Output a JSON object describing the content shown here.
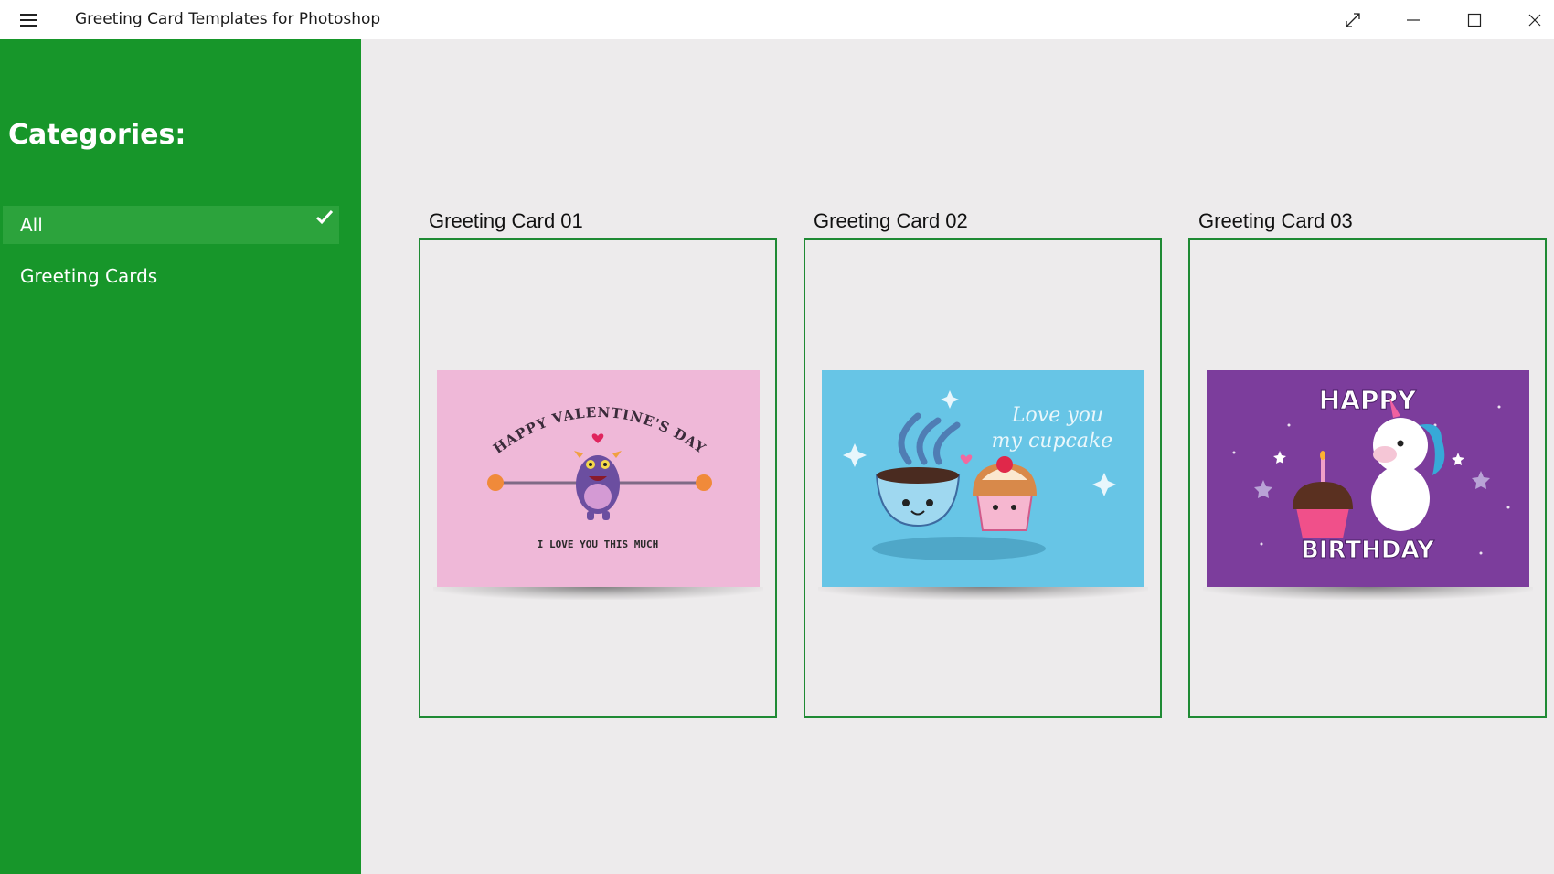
{
  "window": {
    "title": "Greeting Card Templates for Photoshop"
  },
  "sidebar": {
    "heading": "Categories:",
    "items": [
      {
        "label": "All",
        "selected": true
      },
      {
        "label": "Greeting Cards",
        "selected": false
      }
    ]
  },
  "cards": [
    {
      "title": "Greeting Card 01",
      "art_text_top": "HAPPY VALENTINE'S DAY",
      "art_text_bottom": "I LOVE YOU THIS MUCH",
      "bg": "#efb8d8"
    },
    {
      "title": "Greeting Card 02",
      "art_text_line1": "Love you",
      "art_text_line2": "my cupcake",
      "bg": "#67c5e6"
    },
    {
      "title": "Greeting Card 03",
      "art_text_top": "HAPPY",
      "art_text_bottom": "BIRTHDAY",
      "bg": "#7c3d9c"
    }
  ],
  "colors": {
    "sidebar_bg": "#17962a",
    "selected_item_bg": "#2ca33c",
    "card_border": "#1f8a34",
    "content_bg": "#edebec"
  }
}
